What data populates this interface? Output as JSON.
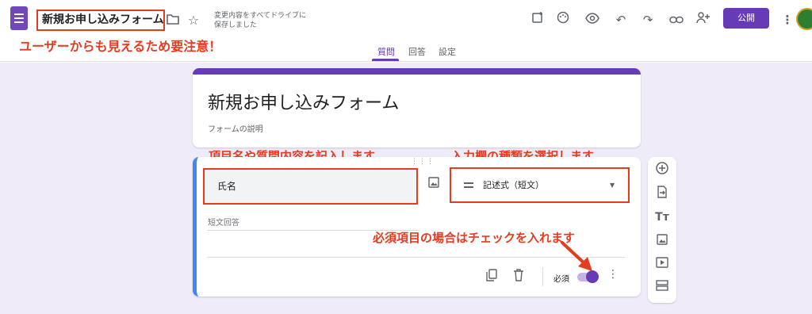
{
  "header": {
    "doc_title": "新規お申し込みフォーム",
    "save_status_line1": "変更内容をすべてドライブに",
    "save_status_line2": "保存しました",
    "publish_label": "公開",
    "tabs": [
      {
        "label": "質問",
        "active": true
      },
      {
        "label": "回答",
        "active": false
      },
      {
        "label": "設定",
        "active": false
      }
    ],
    "toolbar_icons": [
      "addon-icon",
      "palette-icon",
      "preview-eye-icon",
      "undo-icon",
      "redo-icon",
      "link-icon",
      "add-collaborator-icon",
      "more-vert-icon"
    ]
  },
  "form": {
    "title": "新規お申し込みフォーム",
    "description_placeholder": "フォームの説明"
  },
  "question": {
    "title": "氏名",
    "type_label": "記述式（短文）",
    "short_answer_placeholder": "短文回答",
    "required_label": "必須",
    "required": true
  },
  "side_toolbar_icons": [
    "add-question-icon",
    "import-questions-icon",
    "add-title-icon",
    "add-image-icon",
    "add-video-icon",
    "add-section-icon"
  ],
  "annotations": {
    "title_note": "ユーザーからも見えるため要注意！",
    "question_note": "項目名や質問内容を記入します",
    "type_note": "入力欄の種類を選択します",
    "required_note": "必須項目の場合はチェックを入れます"
  },
  "colors": {
    "accent": "#673ab7",
    "annotation": "#e53b1f",
    "canvas": "#f0ebf8",
    "question_border": "#4285f4"
  }
}
